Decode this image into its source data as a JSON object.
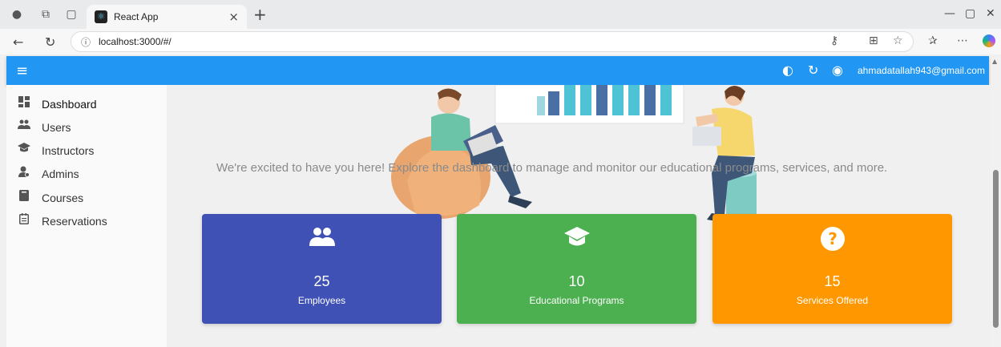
{
  "browser": {
    "tab_title": "React App",
    "url": "localhost:3000/#/"
  },
  "appbar": {
    "user_email": "ahmadatallah943@gmail.com"
  },
  "sidebar": {
    "items": [
      {
        "label": "Dashboard",
        "icon": "dashboard-icon"
      },
      {
        "label": "Users",
        "icon": "users-icon"
      },
      {
        "label": "Instructors",
        "icon": "graduation-cap-icon"
      },
      {
        "label": "Admins",
        "icon": "admin-icon"
      },
      {
        "label": "Courses",
        "icon": "book-icon"
      },
      {
        "label": "Reservations",
        "icon": "calendar-icon"
      }
    ]
  },
  "main": {
    "welcome_text": "We're excited to have you here! Explore the dashboard to manage and monitor our educational programs, services, and more.",
    "cards": [
      {
        "value": "25",
        "label": "Employees",
        "icon": "users-icon",
        "color": "#3f51b5"
      },
      {
        "value": "10",
        "label": "Educational Programs",
        "icon": "graduation-cap-icon",
        "color": "#4caf50"
      },
      {
        "value": "15",
        "label": "Services Offered",
        "icon": "help-circle-icon",
        "color": "#ff9800"
      }
    ]
  },
  "colors": {
    "appbar": "#2196f3",
    "sidebar_bg": "#fafafa",
    "main_bg": "#f0f0f0"
  }
}
